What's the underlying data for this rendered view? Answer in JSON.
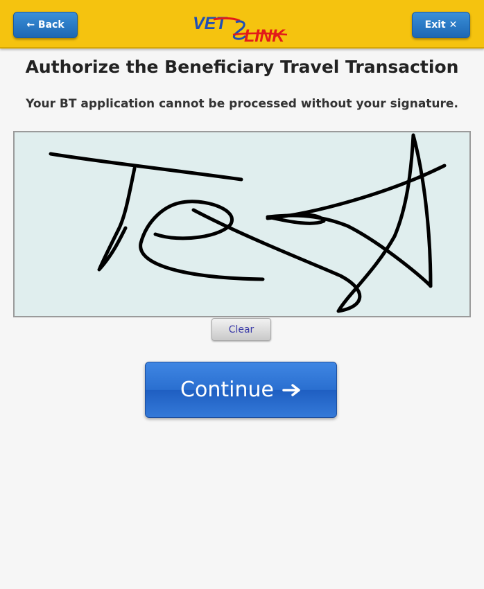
{
  "header": {
    "back_label": "← Back",
    "exit_label": "Exit ✕",
    "logo": {
      "text_left": "VET",
      "text_right": "LINK",
      "text_color": "#1f4fb5",
      "accent_color": "#e21a1a",
      "icon": "vetlink-logo"
    },
    "background_color": "#f5c30f",
    "button_color": "#2a7ac6"
  },
  "main": {
    "title": "Authorize the Beneficiary Travel Transaction",
    "subtitle": "Your BT application cannot be processed without your signature.",
    "signature_pad": {
      "background_color": "#e0eeee",
      "signature": "Test (handwritten signature)"
    },
    "clear_label": "Clear",
    "continue_label": "Continue",
    "continue_icon": "arrow-right-icon"
  }
}
